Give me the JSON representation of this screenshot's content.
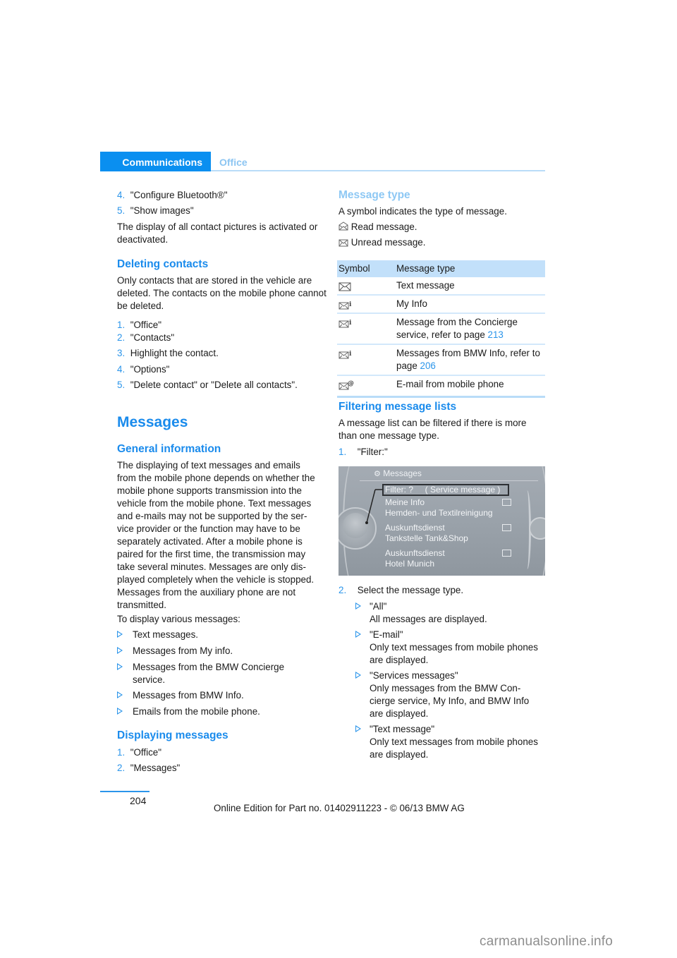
{
  "header": {
    "section": "Communications",
    "subsection": "Office"
  },
  "left": {
    "steps_top": [
      {
        "num": "4.",
        "text": "\"Configure Bluetooth®\""
      },
      {
        "num": "5.",
        "text": "\"Show images\""
      }
    ],
    "show_images_note": "The display of all contact pictures is activated or deactivated.",
    "deleting_contacts": {
      "heading": "Deleting contacts",
      "intro": "Only contacts that are stored in the vehicle are deleted. The contacts on the mobile phone cannot be deleted.",
      "steps": [
        {
          "num": "1.",
          "text": "\"Office\""
        },
        {
          "num": "2.",
          "text": "\"Contacts\""
        },
        {
          "num": "3.",
          "text": "Highlight the contact."
        },
        {
          "num": "4.",
          "text": "\"Options\""
        },
        {
          "num": "5.",
          "text": "\"Delete contact\" or \"Delete all contacts\"."
        }
      ]
    },
    "messages_heading": "Messages",
    "general_information": {
      "heading": "General information",
      "body": "The displaying of text messages and emails from the mobile phone depends on whether the mobile phone supports transmission into the vehicle from the mobile phone. Text messages and e-mails may not be supported by the ser-vice provider or the function may have to be separately activated. After a mobile phone is paired for the first time, the transmission may take several minutes. Messages are only dis-played completely when the vehicle is stopped. Messages from the auxiliary phone are not transmitted.",
      "lines": [
        "The displaying of text messages and emails",
        "from the mobile phone depends on whether the",
        "mobile phone supports transmission into the",
        "vehicle from the mobile phone. Text messages",
        "and e-mails may not be supported by the ser-",
        "vice provider or the function may have to be",
        "separately activated. After a mobile phone is",
        "paired for the first time, the transmission may",
        "take several minutes. Messages are only dis-",
        "played completely when the vehicle is stopped.",
        "Messages from the auxiliary phone are not",
        "transmitted."
      ],
      "list_intro": "To display various messages:",
      "bullets": [
        "Text messages.",
        "Messages from My info.",
        "Messages from the BMW Concierge service.",
        "Messages from BMW Info.",
        "Emails from the mobile phone."
      ]
    },
    "displaying_messages": {
      "heading": "Displaying messages",
      "steps": [
        {
          "num": "1.",
          "text": "\"Office\""
        },
        {
          "num": "2.",
          "text": "\"Messages\""
        }
      ]
    }
  },
  "right": {
    "message_type": {
      "heading": "Message type",
      "intro": "A symbol indicates the type of message.",
      "read": {
        "icon": "envelope-open-icon",
        "text": "Read message."
      },
      "unread": {
        "icon": "envelope-closed-icon",
        "text": "Unread message."
      }
    },
    "table": {
      "headers": [
        "Symbol",
        "Message type"
      ],
      "rows": [
        {
          "icon": "envelope-icon",
          "text": "Text message",
          "link": ""
        },
        {
          "icon": "envelope-info-icon",
          "text": "My Info",
          "link": ""
        },
        {
          "icon": "envelope-info-icon",
          "text": "Message from the Concierge service, refer to page ",
          "link": "213"
        },
        {
          "icon": "envelope-info-icon",
          "text": "Messages from BMW Info, refer to page ",
          "link": "206"
        },
        {
          "icon": "envelope-at-icon",
          "text": "E-mail from mobile phone",
          "link": ""
        }
      ]
    },
    "filtering": {
      "heading": "Filtering message lists",
      "intro": "A message list can be filtered if there is more than one message type.",
      "step1": {
        "num": "1.",
        "text": "\"Filter:\""
      },
      "screen": {
        "title": "Messages",
        "filter_row": "Filter: ?     ( Service message )",
        "items": [
          {
            "line1": "Meine Info",
            "line2": "Hemden- und Textilreinigung"
          },
          {
            "line1": "Auskunftsdienst",
            "line2": "Tankstelle Tank&Shop"
          },
          {
            "line1": "Auskunftsdienst",
            "line2": "Hotel Munich"
          }
        ]
      },
      "step2": {
        "num": "2.",
        "text": "Select the message type."
      },
      "options": [
        {
          "label": "\"All\"",
          "desc": "All messages are displayed."
        },
        {
          "label": "\"E-mail\"",
          "desc": "Only text messages from mobile phones are displayed."
        },
        {
          "label": "\"Services messages\"",
          "desc": "Only messages from the BMW Con-cierge service, My Info, and BMW Info are displayed."
        },
        {
          "label": "\"Text message\"",
          "desc": "Only text messages from mobile phones are displayed."
        }
      ]
    }
  },
  "footer": {
    "page_number": "204",
    "edition": "Online Edition for Part no. 01402911223 - © 06/13 BMW AG",
    "watermark": "carmanualsonline.info"
  },
  "colors": {
    "accent": "#1a8bec",
    "accent_light": "#8ec8f4",
    "table_header": "#c2e0fa"
  }
}
